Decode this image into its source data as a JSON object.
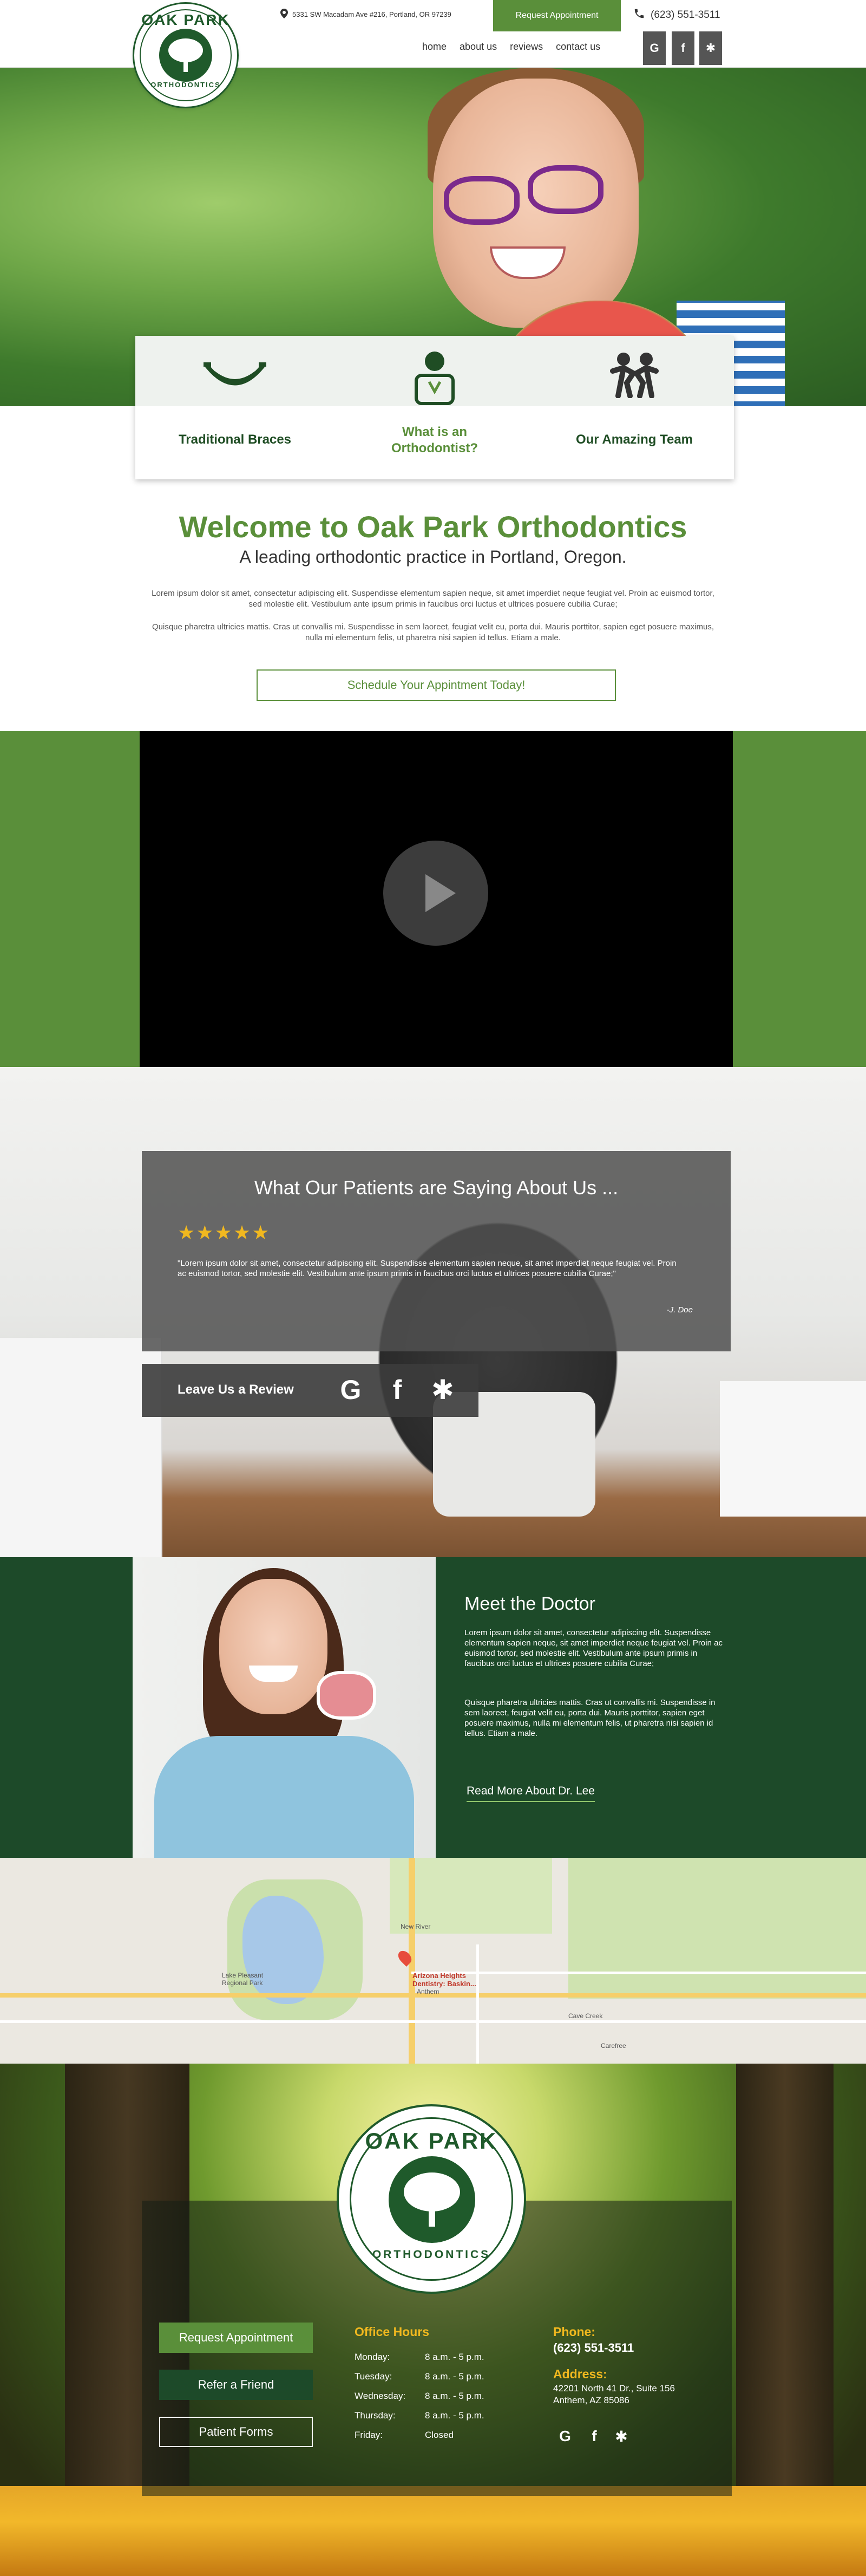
{
  "header": {
    "address": "5331 SW Macadam Ave #216, Portland, OR 97239",
    "request_label": "Request Appointment",
    "phone": "(623) 551-3511",
    "nav": [
      "home",
      "about us",
      "reviews",
      "contact us"
    ],
    "logo_top": "OAK PARK",
    "logo_bottom": "ORTHODONTICS"
  },
  "features": [
    {
      "label": "Traditional Braces",
      "icon": "smile-icon"
    },
    {
      "label": "What is an Orthodontist?",
      "icon": "orthodontist-icon"
    },
    {
      "label": "Our Amazing Team",
      "icon": "team-icon"
    }
  ],
  "welcome": {
    "title": "Welcome to Oak Park Orthodontics",
    "subtitle": "A leading orthodontic practice in Portland, Oregon.",
    "p1": "Lorem ipsum dolor sit amet, consectetur adipiscing elit. Suspendisse elementum sapien neque, sit amet imperdiet neque feugiat vel. Proin ac euismod tortor, sed molestie elit. Vestibulum ante ipsum primis in faucibus orci luctus et ultrices posuere cubilia Curae;",
    "p2": "Quisque pharetra ultricies mattis. Cras ut convallis mi. Suspendisse in sem laoreet, feugiat velit eu, porta dui. Mauris porttitor, sapien eget posuere maximus, nulla mi elementum felis, ut pharetra nisi sapien id tellus. Etiam a male.",
    "cta": "Schedule Your Appintment Today!"
  },
  "testimonial": {
    "title": "What Our Patients are Saying About Us ...",
    "stars": "★★★★★",
    "rating": 5,
    "quote": "\"Lorem ipsum dolor sit amet, consectetur adipiscing elit. Suspendisse elementum sapien neque, sit amet imperdiet neque feugiat vel. Proin ac euismod tortor, sed molestie elit. Vestibulum ante ipsum primis in faucibus orci luctus et ultrices posuere cubilia Curae;\"",
    "author": "-J. Doe",
    "review_label": "Leave Us a Review"
  },
  "doctor": {
    "title": "Meet the Doctor",
    "p1": "Lorem ipsum dolor sit amet, consectetur adipiscing elit. Suspendisse elementum sapien neque, sit amet imperdiet neque feugiat vel. Proin ac euismod tortor, sed molestie elit. Vestibulum ante ipsum primis in faucibus orci luctus et ultrices posuere cubilia Curae;",
    "p2": "Quisque pharetra ultricies mattis. Cras ut convallis mi. Suspendisse in sem laoreet, feugiat velit eu, porta dui. Mauris porttitor, sapien eget posuere maximus, nulla mi elementum felis, ut pharetra nisi sapien id tellus. Etiam a male.",
    "link": "Read More About Dr. Lee"
  },
  "map": {
    "place": "Arizona Heights Dentistry: Baskin...",
    "labels": {
      "new_river": "New River",
      "lake": "Lake Pleasant Regional Park",
      "cave_creek": "Cave Creek",
      "carefree": "Carefree",
      "anthem": "Anthem"
    }
  },
  "footer": {
    "logo_top": "OAK PARK",
    "logo_bottom": "ORTHODONTICS",
    "buttons": [
      "Request Appointment",
      "Refer a Friend",
      "Patient Forms"
    ],
    "hours_title": "Office Hours",
    "hours": [
      {
        "day": "Monday:",
        "time": "8 a.m. - 5 p.m."
      },
      {
        "day": "Tuesday:",
        "time": "8 a.m. - 5 p.m."
      },
      {
        "day": "Wednesday:",
        "time": "8 a.m. - 5 p.m."
      },
      {
        "day": "Thursday:",
        "time": "8 a.m. - 5 p.m."
      },
      {
        "day": "Friday:",
        "time": "Closed"
      }
    ],
    "phone_title": "Phone:",
    "phone": "(623) 551-3511",
    "address_title": "Address:",
    "address1": "42201 North 41 Dr., Suite 156",
    "address2": "Anthem, AZ 85086"
  },
  "colors": {
    "brand_green": "#5a8f3a",
    "dark_green": "#1d4a29",
    "gold": "#f1b81f"
  }
}
